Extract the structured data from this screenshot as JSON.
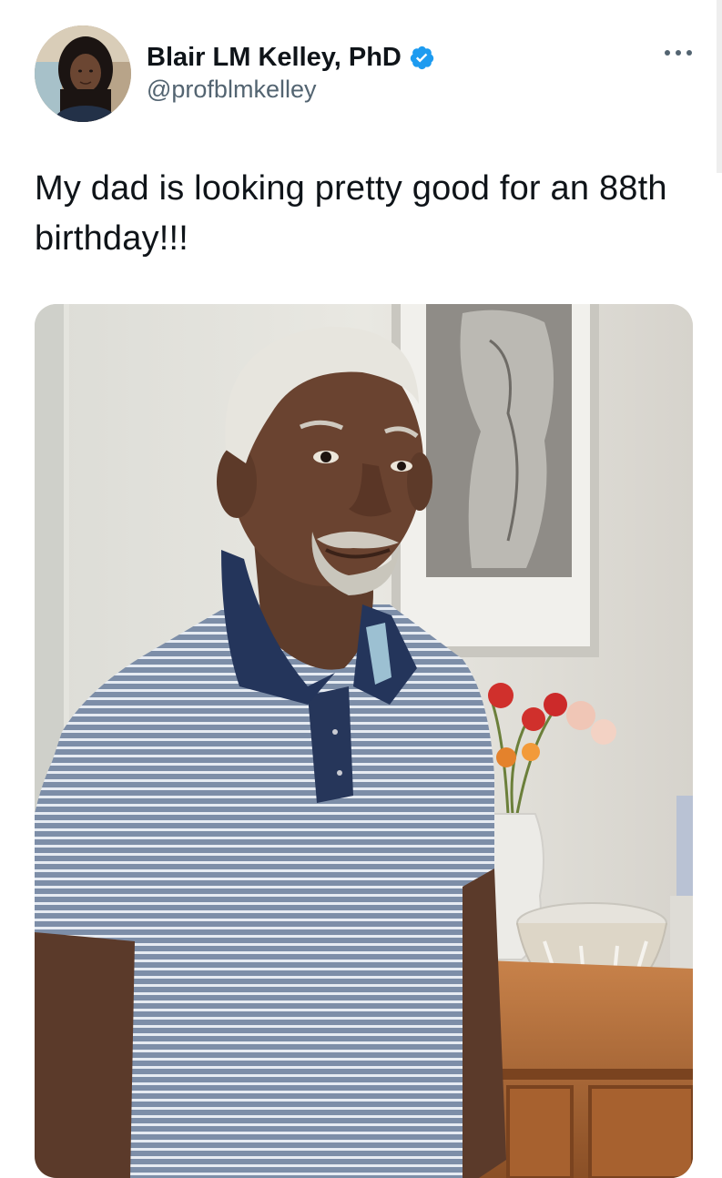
{
  "tweet": {
    "author_name": "Blair LM Kelley, PhD",
    "author_handle": "@profblmkelley",
    "verified": true,
    "text": "My dad is looking pretty good for an 88th birthday!!!",
    "media_description_icon": "photo"
  },
  "colors": {
    "verified_blue": "#1d9bf0",
    "handle_gray": "#536471",
    "text_dark": "#0f1419"
  },
  "icons": {
    "verified": "verified-badge-icon",
    "more": "more-options-icon"
  }
}
